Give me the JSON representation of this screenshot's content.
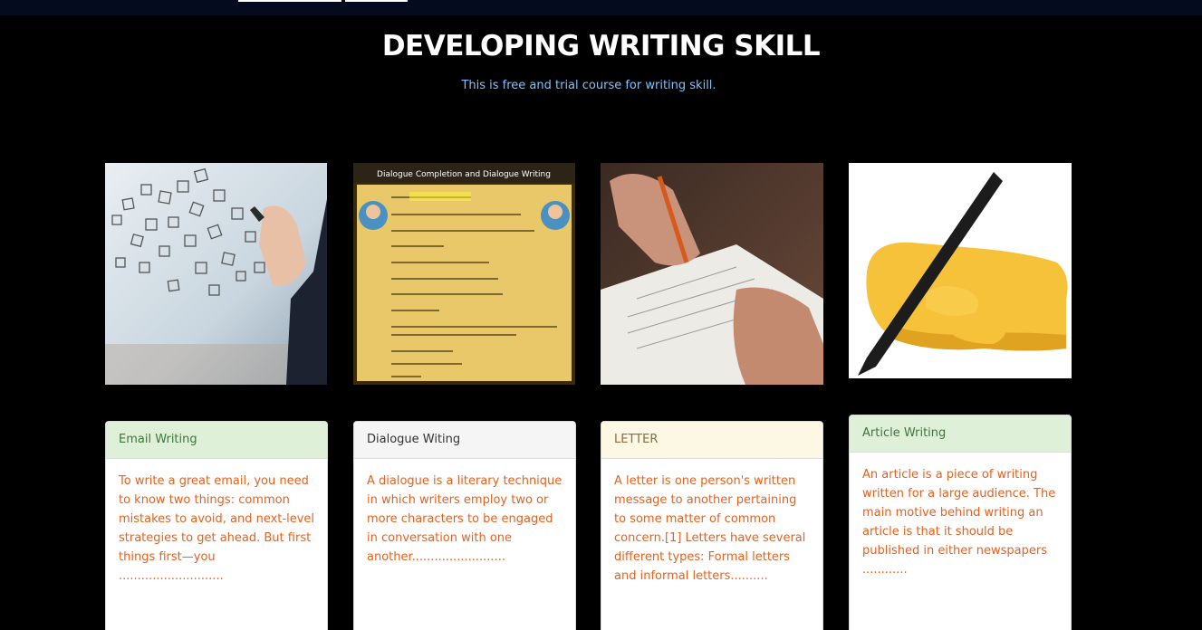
{
  "header": {
    "title": "DEVELOPING WRITING SKILL",
    "subtitle": "This is free and trial course for writing skill."
  },
  "colors": {
    "background": "#000000",
    "topbar": "#050b1f",
    "subtitle": "#7fc4ff",
    "body_text": "#e4621f"
  },
  "images": [
    {
      "name": "email-image",
      "icon": "email-checkbox-image"
    },
    {
      "name": "dialogue-image",
      "icon": "dialogue-sheet-image"
    },
    {
      "name": "letter-image",
      "icon": "hand-writing-paper-image"
    },
    {
      "name": "article-image",
      "icon": "writing-hand-emoji"
    }
  ],
  "cards": [
    {
      "header": "Email Writing",
      "body": "To write a great email, you need to know two things: common mistakes to avoid, and next-level strategies to get ahead. But first things first—you ............................"
    },
    {
      "header": "Dialogue Witing",
      "body": "A dialogue is a literary technique in which writers employ two or more characters to be engaged in conversation with one another........................."
    },
    {
      "header": "LETTER",
      "body": "A letter is one person's written message to another pertaining to some matter of common concern.[1] Letters have several different types: Formal letters and informal letters.........."
    },
    {
      "header": "Article Writing",
      "body": "An article is a piece of writing written for a large audience. The main motive behind writing an article is that it should be published in either newspapers ............"
    }
  ]
}
